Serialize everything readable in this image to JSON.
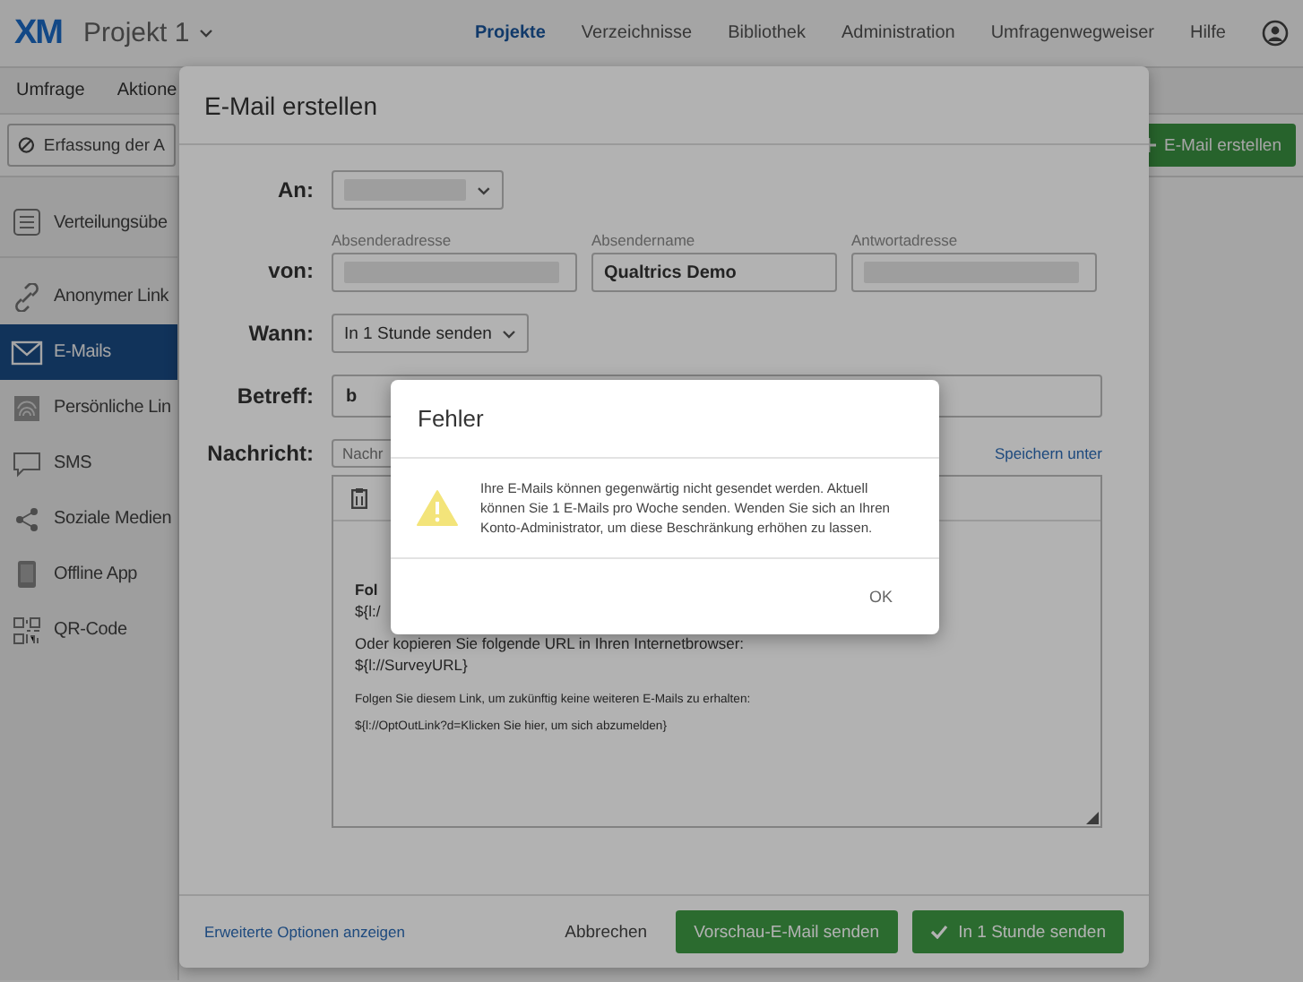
{
  "topbar": {
    "logo": "XM",
    "project": "Projekt 1",
    "nav": [
      {
        "label": "Projekte",
        "selected": true
      },
      {
        "label": "Verzeichnisse",
        "selected": false
      },
      {
        "label": "Bibliothek",
        "selected": false
      },
      {
        "label": "Administration",
        "selected": false
      },
      {
        "label": "Umfragenwegweiser",
        "selected": false
      },
      {
        "label": "Hilfe",
        "selected": false
      }
    ]
  },
  "subnav": {
    "tabs": [
      "Umfrage",
      "Aktione"
    ]
  },
  "toolbar": {
    "filter_button": "Erfassung der A",
    "create_button": "E-Mail erstellen"
  },
  "sidebar": {
    "items": [
      {
        "label": "Verteilungsübe",
        "selected": false
      },
      {
        "label": "Anonymer Link",
        "selected": false
      },
      {
        "label": "E-Mails",
        "selected": true
      },
      {
        "label": "Persönliche Lin",
        "selected": false
      },
      {
        "label": "SMS",
        "selected": false
      },
      {
        "label": "Soziale Medien",
        "selected": false
      },
      {
        "label": "Offline App",
        "selected": false
      },
      {
        "label": "QR-Code",
        "selected": false
      }
    ]
  },
  "modal": {
    "title": "E-Mail erstellen",
    "to": {
      "label": "An:"
    },
    "from": {
      "label": "von:",
      "fields": [
        {
          "caption": "Absenderadresse"
        },
        {
          "caption": "Absendername",
          "value": "Qualtrics Demo"
        },
        {
          "caption": "Antwortadresse"
        }
      ]
    },
    "when": {
      "label": "Wann:",
      "value": "In 1 Stunde senden"
    },
    "subject": {
      "label": "Betreff:",
      "value": "b"
    },
    "message": {
      "label": "Nachricht:",
      "template": "Nachr",
      "save_link": "Speichern unter",
      "body": [
        {
          "kind": "normal",
          "lines": [
            {
              "text": "Fol",
              "bold": true
            },
            {
              "text": "${l:/",
              "bold": false
            }
          ]
        },
        {
          "kind": "normal",
          "lines": [
            {
              "text": "Oder kopieren Sie folgende URL in Ihren Internetbrowser:",
              "bold": false
            },
            {
              "text": "${l://SurveyURL}",
              "bold": false
            }
          ]
        },
        {
          "kind": "small",
          "lines": [
            {
              "text": "Folgen Sie diesem Link, um zukünftig keine weiteren E-Mails zu erhalten:",
              "bold": false
            },
            {
              "text": "${l://OptOutLink?d=Klicken Sie hier, um sich abzumelden}",
              "bold": false
            }
          ]
        }
      ]
    },
    "footer": {
      "advanced_link": "Erweiterte Optionen anzeigen",
      "cancel": "Abbrechen",
      "preview_button": "Vorschau-E-Mail senden",
      "send_button": "In 1 Stunde senden"
    }
  },
  "error_dialog": {
    "title": "Fehler",
    "message": "Ihre E-Mails können gegenwärtig nicht gesendet werden. Aktuell können Sie 1 E-Mails pro Woche senden. Wenden Sie sich an Ihren Konto-Administrator, um diese Beschränkung erhöhen zu lassen.",
    "ok": "OK"
  }
}
